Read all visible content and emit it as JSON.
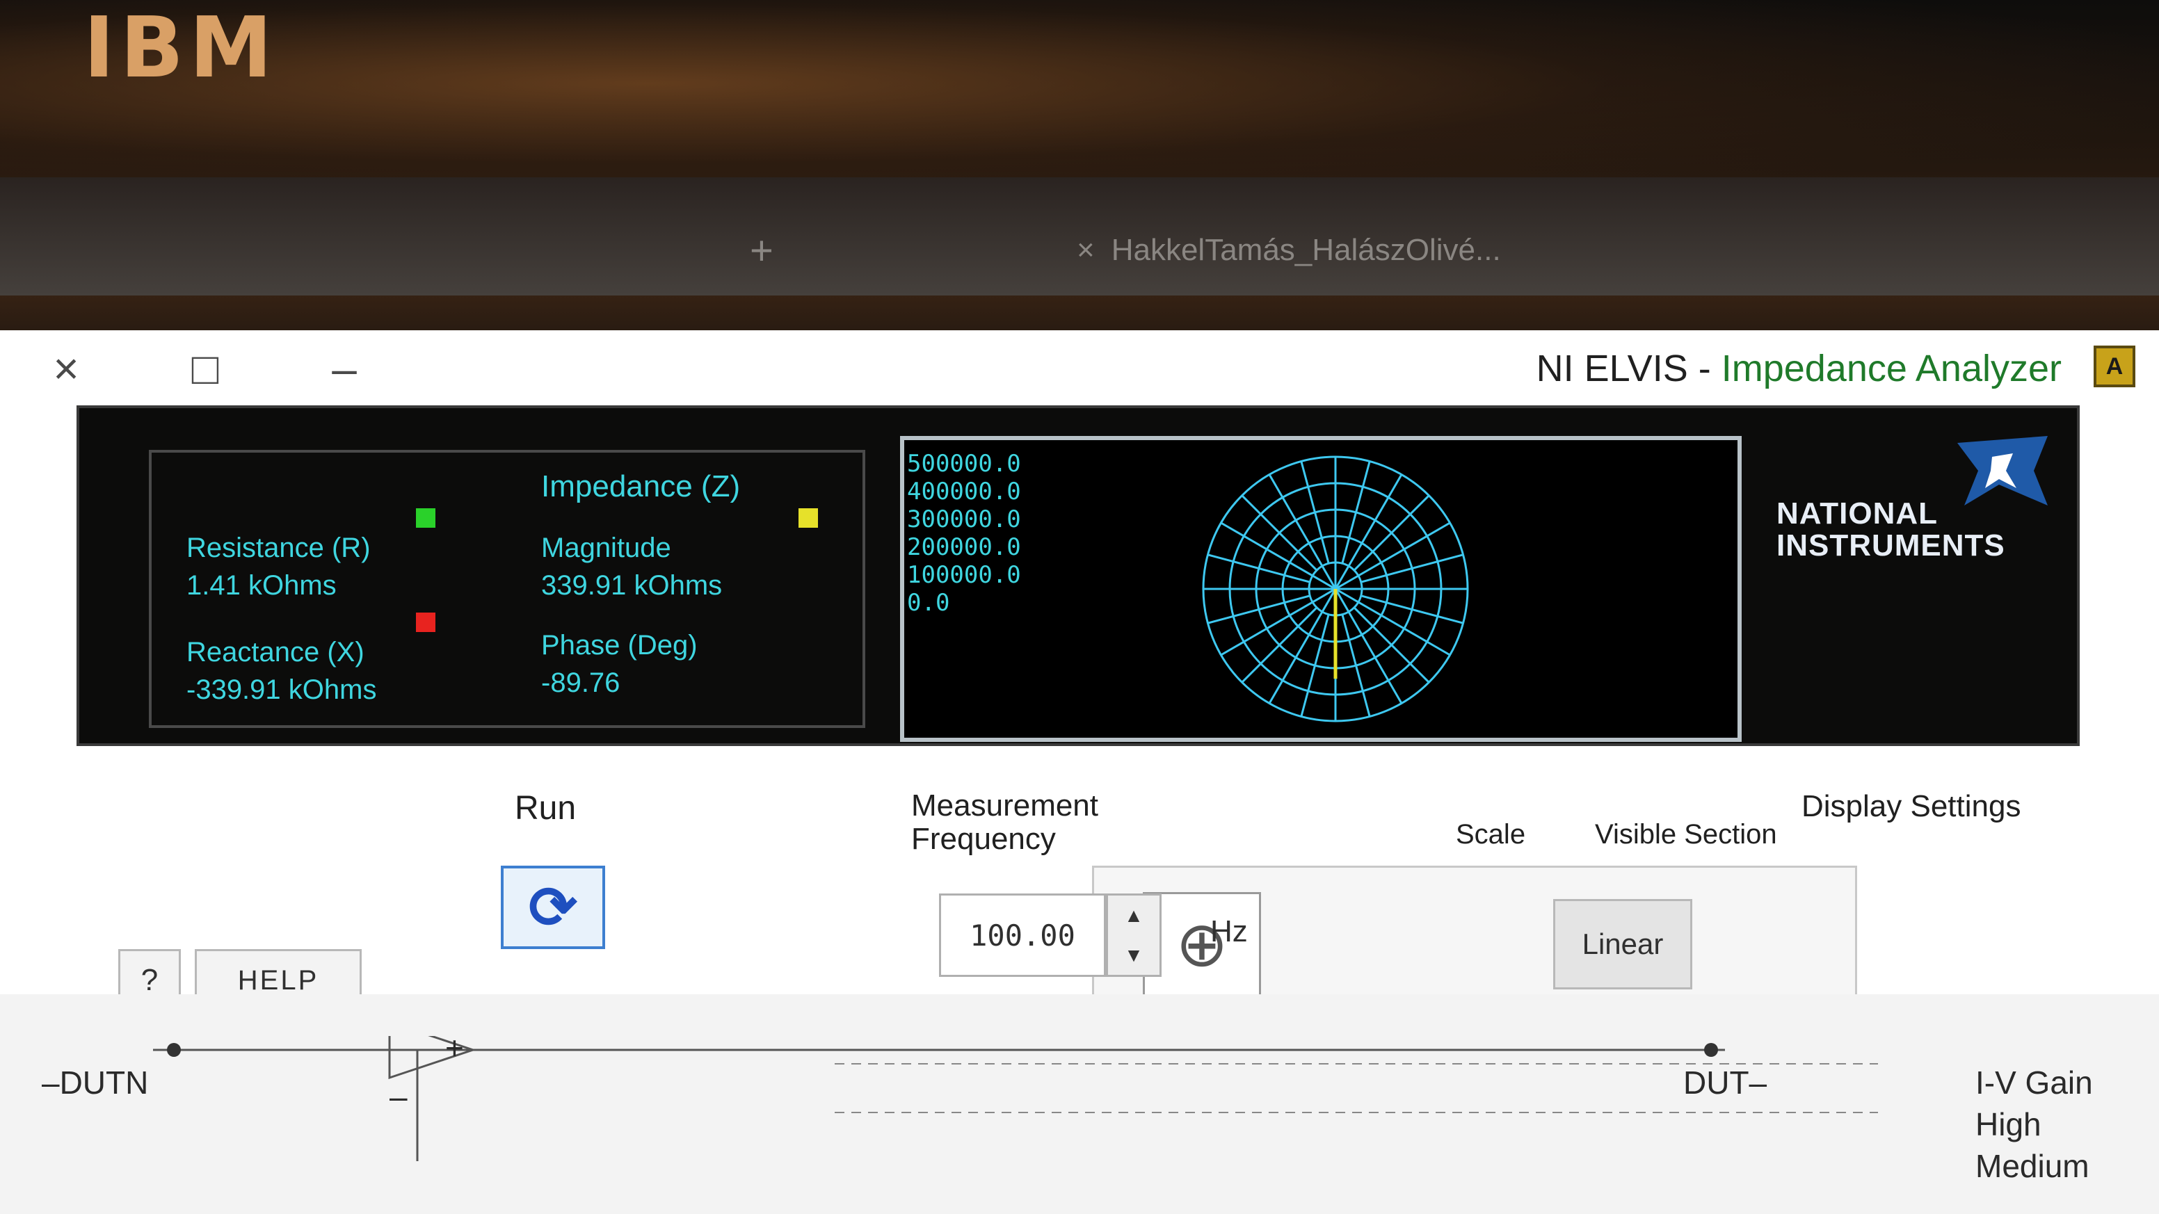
{
  "monitor": {
    "logo": "IBM"
  },
  "browser": {
    "tabs": [
      {
        "label": "HakkelTamás_HalászOlivé...",
        "close": "×"
      }
    ],
    "new_tab": "+"
  },
  "window": {
    "title_prefix": "NI ELVIS - ",
    "title_main": "Impedance Analyzer",
    "icon_glyph": "A",
    "controls": {
      "minimize": "–",
      "maximize": "□",
      "close": "×"
    }
  },
  "brand": {
    "line1": "NATIONAL",
    "line2": "INSTRUMENTS"
  },
  "polar_scale": [
    "500000.0",
    "400000.0",
    "300000.0",
    "200000.0",
    "100000.0",
    "0.0"
  ],
  "impedance": {
    "title": "Impedance (Z)",
    "magnitude_label": "Magnitude",
    "magnitude_value": "339.91 kOhms",
    "phase_label": "Phase (Deg)",
    "phase_value": "-89.76",
    "resistance_label": "Resistance (R)",
    "resistance_value": "1.41 kOhms",
    "reactance_label": "Reactance (X)",
    "reactance_value": "-339.91 kOhms",
    "colors": {
      "magnitude": "#e6e12a",
      "resistance": "#2ad12a",
      "reactance": "#e8231f"
    }
  },
  "display_settings": {
    "heading": "Display Settings",
    "visible_section_label": "Visible Section",
    "scale_label": "Scale",
    "scale_value": "Linear"
  },
  "measurement": {
    "label_line1": "Measurement",
    "label_line2": "Frequency",
    "frequency_value": "100.00",
    "unit": "Hz"
  },
  "run": {
    "label": "Run"
  },
  "help": {
    "label": "HELP",
    "question": "?"
  },
  "schematic": {
    "dut_minus": "DUT–",
    "dut_plus": "–DUTN",
    "iv_gain": "I-V Gain",
    "high": "High",
    "medium": "Medium",
    "plus": "+",
    "minus": "–"
  }
}
